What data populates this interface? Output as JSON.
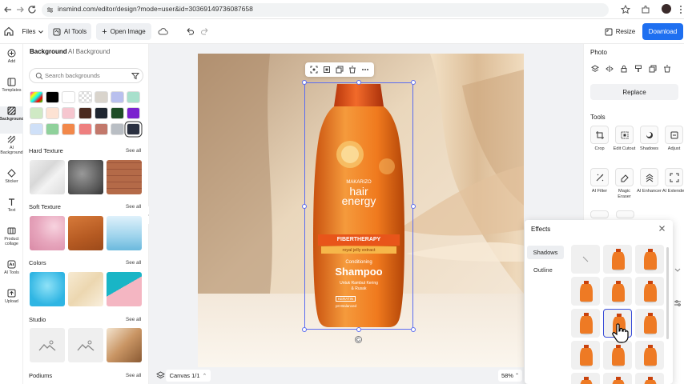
{
  "browser": {
    "url": "insmind.com/editor/design?mode=user&id=303691497360876​58"
  },
  "toolbar": {
    "files": "Files",
    "ai_tools": "AI Tools",
    "open_image": "Open Image",
    "resize": "Resize",
    "download": "Download"
  },
  "rail": [
    {
      "label": "Add",
      "icon": "plus-circle-icon"
    },
    {
      "label": "Templates",
      "icon": "templates-icon"
    },
    {
      "label": "Background",
      "icon": "background-icon"
    },
    {
      "label": "AI Background",
      "icon": "ai-background-icon"
    },
    {
      "label": "Sticker",
      "icon": "sticker-icon"
    },
    {
      "label": "Text",
      "icon": "text-icon"
    },
    {
      "label": "Product collage",
      "icon": "collage-icon"
    },
    {
      "label": "AI Tools",
      "icon": "ai-tools-icon"
    },
    {
      "label": "Upload",
      "icon": "upload-icon"
    }
  ],
  "bgpanel": {
    "tab_background": "Background",
    "tab_ai_background": "AI Background",
    "search_placeholder": "Search backgrounds",
    "sections": {
      "hard_texture": "Hard Texture",
      "soft_texture": "Soft Texture",
      "colors": "Colors",
      "studio": "Studio",
      "podiums": "Podiums"
    },
    "see_all": "See all"
  },
  "swatches": [
    "#888888",
    "#000000",
    "#ffffff",
    "#ededed",
    "#d9d4cc",
    "#b9c0ee",
    "#a8e0cc",
    "#cfe9c4",
    "#fde2d3",
    "#f6c6cf",
    "#4a2a1f",
    "#1f2630",
    "#1e4d26",
    "#7b22cf",
    "#cfe0f8",
    "#8fd19b",
    "#f2884a",
    "#ee7f7f",
    "#c2786b",
    "#b9bec4",
    "#2a3040"
  ],
  "canvas": {
    "footer_label": "Canvas 1/1",
    "zoom": "58%"
  },
  "product": {
    "brand": "MAKARIZO",
    "line1": "hair",
    "line2": "energy",
    "band1": "FIBERTHERAPY",
    "band2": "royal jelly extract",
    "cond": "Conditioning",
    "name": "Shampoo",
    "desc1": "Untuk Rambut Kering",
    "desc2": "& Rusak",
    "tag": "KERATIN",
    "tag2": "pH-Balanced"
  },
  "rpanel": {
    "photo_title": "Photo",
    "replace": "Replace",
    "tools_title": "Tools",
    "tools": [
      {
        "label": "Crop",
        "icon": "crop-icon"
      },
      {
        "label": "Edit Cutout",
        "icon": "edit-cutout-icon"
      },
      {
        "label": "Shadows",
        "icon": "shadows-icon"
      },
      {
        "label": "Adjust",
        "icon": "adjust-icon"
      },
      {
        "label": "AI Filter",
        "icon": "ai-filter-icon"
      },
      {
        "label": "Magic Eraser",
        "icon": "magic-eraser-icon"
      },
      {
        "label": "AI Enhancer",
        "icon": "ai-enhancer-icon"
      },
      {
        "label": "AI Extender",
        "icon": "ai-extender-icon"
      }
    ]
  },
  "effects": {
    "title": "Effects",
    "tab_shadows": "Shadows",
    "tab_outline": "Outline"
  },
  "colors": {
    "accent": "#1e6ff0",
    "selection": "#5b6cf0"
  }
}
